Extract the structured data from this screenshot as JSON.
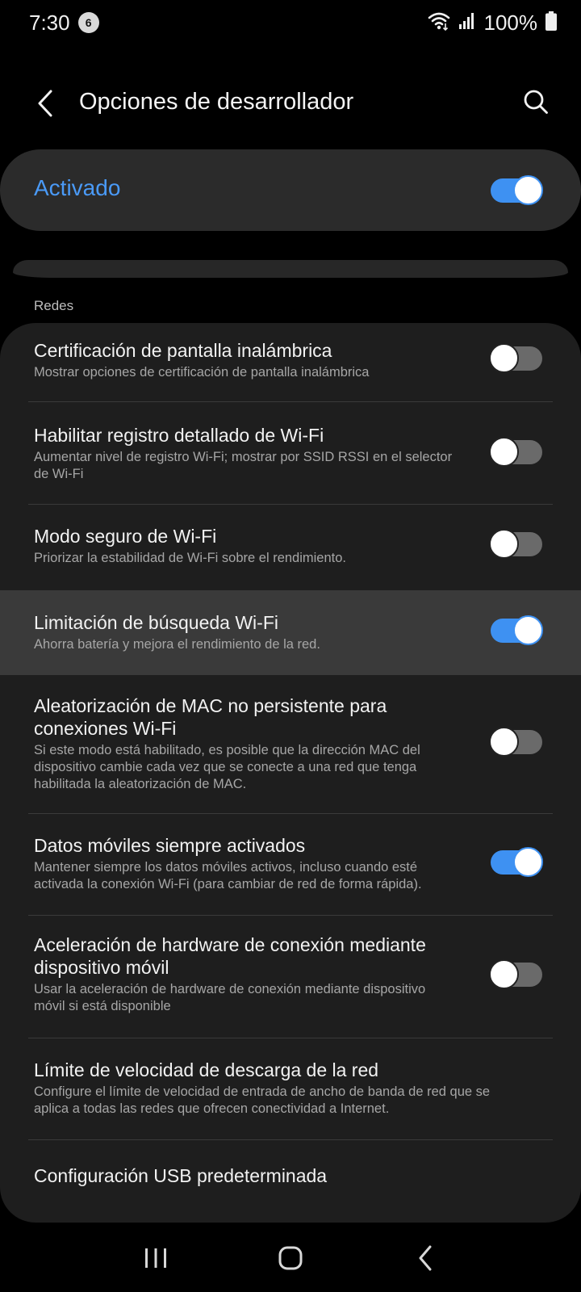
{
  "status_bar": {
    "time": "7:30",
    "notification_count": "6",
    "battery": "100%"
  },
  "header": {
    "title": "Opciones de desarrollador"
  },
  "master": {
    "label": "Activado",
    "enabled": true
  },
  "section": {
    "label": "Redes"
  },
  "settings": [
    {
      "title": "Certificación de pantalla inalámbrica",
      "subtitle": "Mostrar opciones de certificación de pantalla inalámbrica",
      "enabled": false
    },
    {
      "title": "Habilitar registro detallado de Wi-Fi",
      "subtitle": "Aumentar nivel de registro Wi-Fi; mostrar por SSID RSSI en el selector de Wi-Fi",
      "enabled": false
    },
    {
      "title": "Modo seguro de Wi-Fi",
      "subtitle": "Priorizar la estabilidad de Wi-Fi sobre el rendimiento.",
      "enabled": false
    },
    {
      "title": "Limitación de búsqueda Wi-Fi",
      "subtitle": "Ahorra batería y mejora el rendimiento de la red.",
      "enabled": true
    },
    {
      "title": "Aleatorización de MAC no persistente para conexiones Wi-Fi",
      "subtitle": "Si este modo está habilitado, es posible que la dirección MAC del dispositivo cambie cada vez que se conecte a una red que tenga habilitada la aleatorización de MAC.",
      "enabled": false
    },
    {
      "title": "Datos móviles siempre activados",
      "subtitle": "Mantener siempre los datos móviles activos, incluso cuando esté activada la conexión Wi-Fi (para cambiar de red de forma rápida).",
      "enabled": true
    },
    {
      "title": "Aceleración de hardware de conexión mediante dispositivo móvil",
      "subtitle": "Usar la aceleración de hardware de conexión mediante dispositivo móvil si está disponible",
      "enabled": false
    },
    {
      "title": "Límite de velocidad de descarga de la red",
      "subtitle": "Configure el límite de velocidad de entrada de ancho de banda de red que se aplica a todas las redes que ofrecen conectividad a Internet."
    },
    {
      "title": "Configuración USB predeterminada"
    }
  ],
  "icons": {
    "back": "back-arrow-icon",
    "search": "search-icon",
    "wifi": "wifi-icon",
    "signal": "signal-icon",
    "battery": "battery-icon",
    "nav_recents": "recents-icon",
    "nav_home": "home-icon",
    "nav_back": "nav-back-icon"
  },
  "colors": {
    "accent": "#3e91f2",
    "master_label": "#4a9af7",
    "background": "#000000",
    "card": "#1e1e1e"
  }
}
